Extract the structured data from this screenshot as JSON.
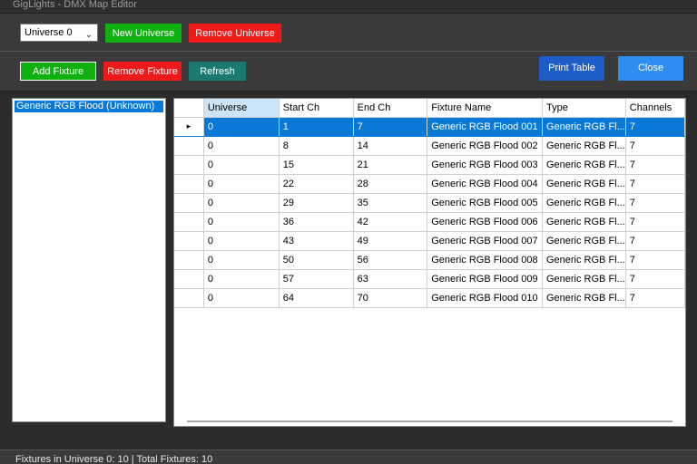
{
  "window": {
    "title": "GigLights - DMX Map Editor"
  },
  "toolbar1": {
    "universe_select": "Universe 0",
    "new_universe": "New Universe",
    "remove_universe": "Remove Universe"
  },
  "toolbar2": {
    "add_fixture": "Add Fixture",
    "remove_fixture": "Remove Fixture",
    "refresh": "Refresh",
    "print_table": "Print Table",
    "close": "Close"
  },
  "fixture_list": {
    "items": [
      "Generic RGB Flood (Unknown)"
    ]
  },
  "table": {
    "columns": [
      "Universe",
      "Start Ch",
      "End Ch",
      "Fixture Name",
      "Type",
      "Channels"
    ],
    "rows": [
      [
        "0",
        "1",
        "7",
        "Generic RGB Flood 001",
        "Generic RGB Fl...",
        "7"
      ],
      [
        "0",
        "8",
        "14",
        "Generic RGB Flood 002",
        "Generic RGB Fl...",
        "7"
      ],
      [
        "0",
        "15",
        "21",
        "Generic RGB Flood 003",
        "Generic RGB Fl...",
        "7"
      ],
      [
        "0",
        "22",
        "28",
        "Generic RGB Flood 004",
        "Generic RGB Fl...",
        "7"
      ],
      [
        "0",
        "29",
        "35",
        "Generic RGB Flood 005",
        "Generic RGB Fl...",
        "7"
      ],
      [
        "0",
        "36",
        "42",
        "Generic RGB Flood 006",
        "Generic RGB Fl...",
        "7"
      ],
      [
        "0",
        "43",
        "49",
        "Generic RGB Flood 007",
        "Generic RGB Fl...",
        "7"
      ],
      [
        "0",
        "50",
        "56",
        "Generic RGB Flood 008",
        "Generic RGB Fl...",
        "7"
      ],
      [
        "0",
        "57",
        "63",
        "Generic RGB Flood 009",
        "Generic RGB Fl...",
        "7"
      ],
      [
        "0",
        "64",
        "70",
        "Generic RGB Flood 010",
        "Generic RGB Fl...",
        "7"
      ]
    ],
    "selected_marker": "▸"
  },
  "status": {
    "text": "Fixtures in Universe 0: 10 | Total Fixtures: 10"
  },
  "colors": {
    "green": "#10b010",
    "red": "#ee1a1a",
    "teal": "#1a7a70",
    "blue": "#1e5cc8",
    "light_blue": "#2e8ef0",
    "selection": "#0a78d7"
  }
}
